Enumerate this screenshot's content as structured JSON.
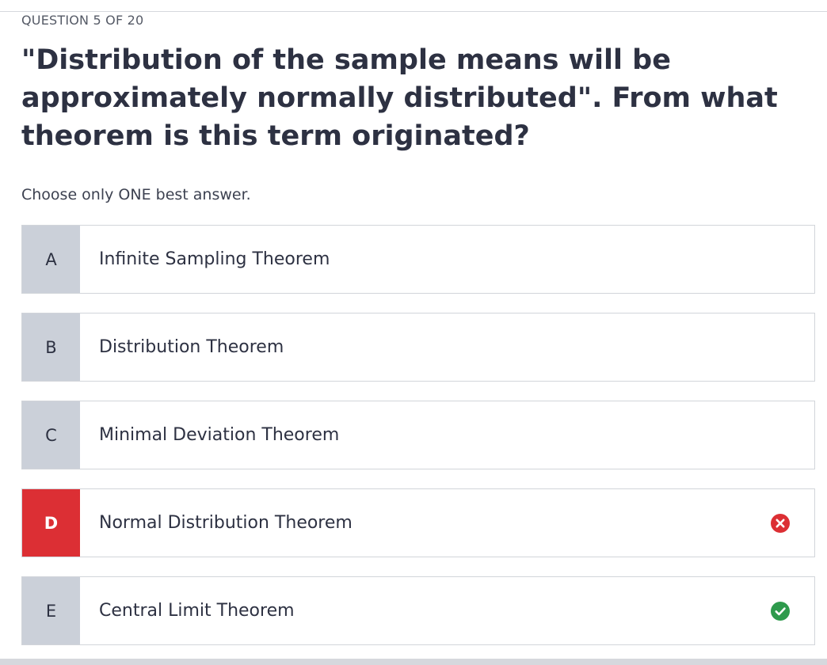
{
  "quiz": {
    "counter": "QUESTION 5 OF 20",
    "question": "\"Distribution of the sample means will be approximately normally distributed\". From what theorem is this term originated?",
    "instruction": "Choose only ONE best answer."
  },
  "options": [
    {
      "letter": "A",
      "text": "Infinite Sampling Theorem",
      "state": "neutral"
    },
    {
      "letter": "B",
      "text": "Distribution Theorem",
      "state": "neutral"
    },
    {
      "letter": "C",
      "text": "Minimal Deviation Theorem",
      "state": "neutral"
    },
    {
      "letter": "D",
      "text": "Normal Distribution Theorem",
      "state": "incorrect",
      "icon": "x-circle-icon"
    },
    {
      "letter": "E",
      "text": "Central Limit Theorem",
      "state": "correct",
      "icon": "check-circle-icon"
    }
  ],
  "colors": {
    "incorrect": "#dc2f34",
    "correct": "#2e9a4c",
    "letter_bg": "#cbd0d9"
  }
}
